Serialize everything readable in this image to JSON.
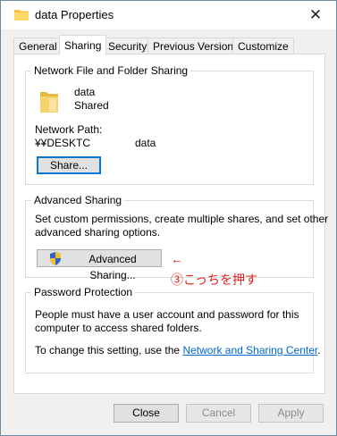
{
  "window": {
    "title": "data Properties"
  },
  "tabs": [
    "General",
    "Sharing",
    "Security",
    "Previous Versions",
    "Customize"
  ],
  "network_sharing": {
    "group_title": "Network File and Folder Sharing",
    "folder_name": "data",
    "status": "Shared",
    "path_label": "Network Path:",
    "path_prefix": "¥¥DESKTC",
    "path_suffix": "data",
    "share_button": "Share..."
  },
  "advanced_sharing": {
    "group_title": "Advanced Sharing",
    "description_line1": "Set custom permissions, create multiple shares, and set other",
    "description_line2": "advanced sharing options.",
    "button_label": "Advanced Sharing..."
  },
  "annotation": {
    "arrow": "←",
    "text": "③こっちを押す"
  },
  "password_protection": {
    "group_title": "Password Protection",
    "line1": "People must have a user account and password for this",
    "line2": "computer to access shared folders.",
    "line3_prefix": "To change this setting, use the ",
    "link": "Network and Sharing Center",
    "line3_suffix": "."
  },
  "footer": {
    "close": "Close",
    "cancel": "Cancel",
    "apply": "Apply"
  }
}
